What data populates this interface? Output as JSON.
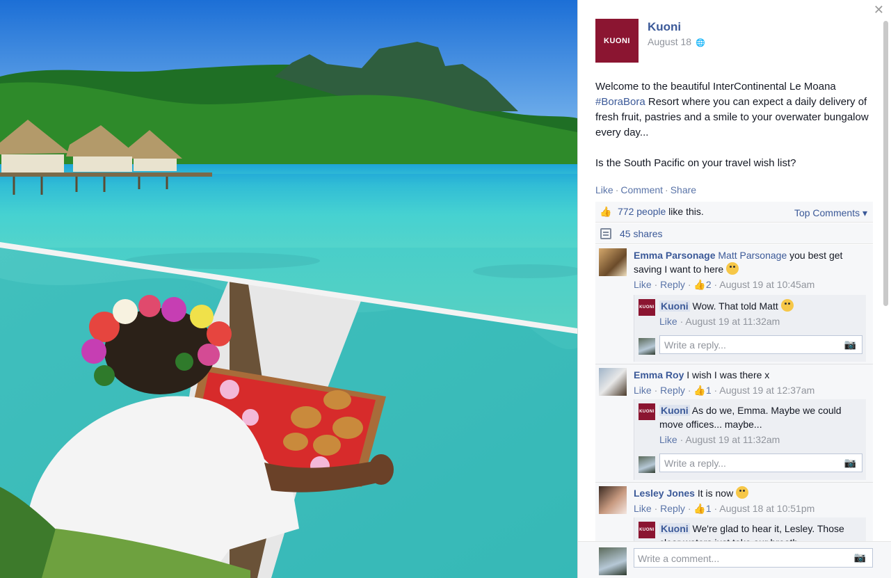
{
  "post": {
    "page_name": "Kuoni",
    "logo_text": "KUONI",
    "date": "August 18",
    "globe_icon": "globe-icon",
    "text_line1": "Welcome to the beautiful InterContinental Le Moana",
    "hashtag": "#BoraBora",
    "text_line2": " Resort where you can expect a daily delivery of fresh fruit, pastries and a smile to your overwater bungalow every day...",
    "text_question": "Is the South Pacific on your travel wish list?"
  },
  "actions": {
    "like": "Like",
    "comment": "Comment",
    "share": "Share",
    "sep": "·"
  },
  "likes": {
    "count": "772 people",
    "suffix": " like this.",
    "top_comments": "Top Comments ▾"
  },
  "shares": {
    "count": "45 shares"
  },
  "comments": [
    {
      "author": "Emma Parsonage",
      "tagged": "Matt Parsonage",
      "text": " you best get saving I want to here",
      "like": "Like",
      "reply": "Reply",
      "likes": "2",
      "time": "August 19 at 10:45am",
      "reply_obj": {
        "author": "Kuoni",
        "text": " Wow. That told Matt",
        "like": "Like",
        "time": "August 19 at 11:32am"
      },
      "reply_placeholder": "Write a reply..."
    },
    {
      "author": "Emma Roy",
      "text": " I wish I was there x",
      "like": "Like",
      "reply": "Reply",
      "likes": "1",
      "time": "August 19 at 12:37am",
      "reply_obj": {
        "author": "Kuoni",
        "text": " As do we, Emma. Maybe we could move offices... maybe...",
        "like": "Like",
        "time": "August 19 at 11:32am"
      },
      "reply_placeholder": "Write a reply..."
    },
    {
      "author": "Lesley Jones",
      "text": " It is now",
      "like": "Like",
      "reply": "Reply",
      "likes": "1",
      "time": "August 18 at 10:51pm",
      "reply_obj": {
        "author": "Kuoni",
        "text": " We're glad to hear it, Lesley. Those clear waters just take our breath..."
      }
    }
  ],
  "comment_box": {
    "placeholder": "Write a comment..."
  },
  "colors": {
    "brand": "#8b1531",
    "link": "#3b5998",
    "meta": "#90949c"
  }
}
